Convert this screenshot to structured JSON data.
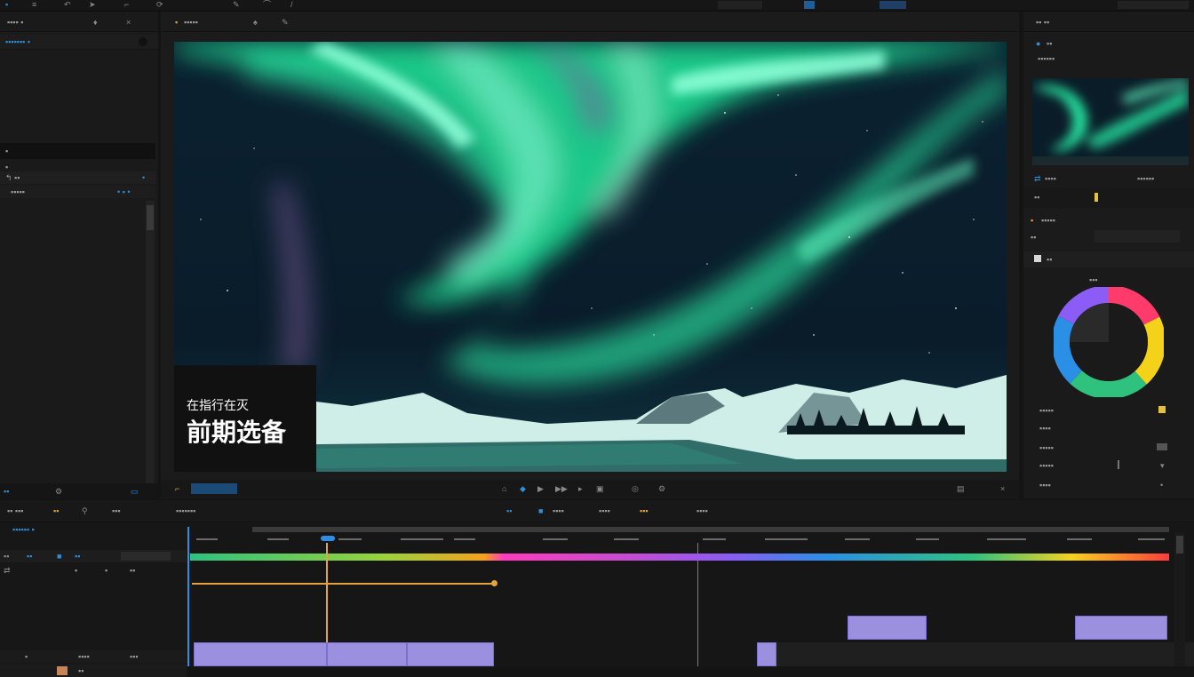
{
  "overlay": {
    "subtitle": "在指行在灭",
    "title": "前期选备"
  },
  "preview": {
    "sky_top": "#0a1a2a",
    "aurora_green": "#27e3a0",
    "aurora_purple": "#7b5b9a",
    "snow": "#bfe7e0"
  },
  "toolbar": {
    "icons": [
      "grid-icon",
      "arrow-icon",
      "cursor-icon",
      "move-icon",
      "pen-icon",
      "brush-icon",
      "rotate-icon"
    ]
  },
  "right_panel": {
    "color_wheel_colors": [
      "#ff3b6b",
      "#f4d21a",
      "#2ec27e",
      "#2b8fe6",
      "#8b5cf6"
    ]
  },
  "timeline": {
    "gradient": [
      "#2ec27e",
      "#f4d21a",
      "#ff3bbf",
      "#8b5cf6",
      "#2b8fe6",
      "#f4d21a",
      "#ff3b3b"
    ],
    "playhead_color": "#2b8fe6",
    "marker_color": "#e6a23c"
  }
}
